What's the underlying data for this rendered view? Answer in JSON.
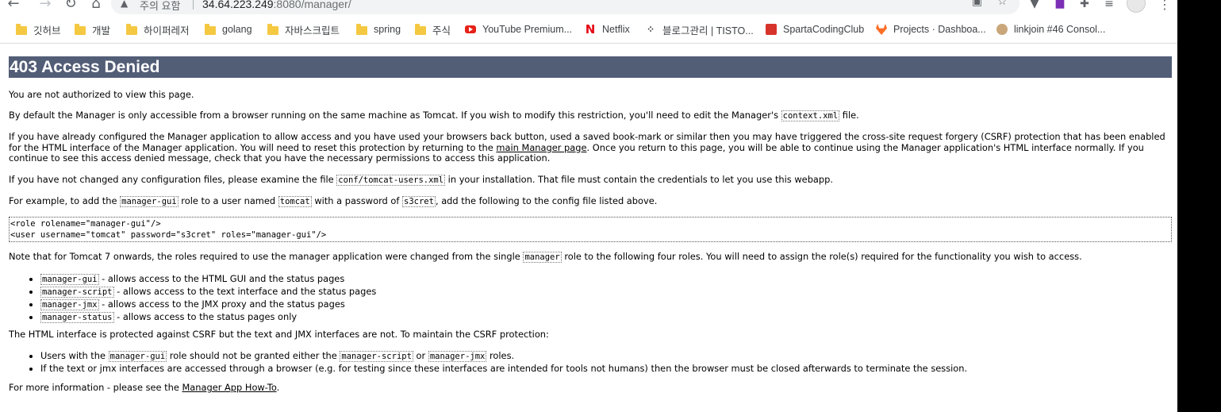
{
  "browser": {
    "security_label": "주의 요함",
    "url_host": "34.64.223.249",
    "url_rest": ":8080/manager/",
    "bookmarks": [
      {
        "label": "깃허브",
        "icon": "folder-icon"
      },
      {
        "label": "개발",
        "icon": "folder-icon"
      },
      {
        "label": "하이퍼레저",
        "icon": "folder-icon"
      },
      {
        "label": "golang",
        "icon": "folder-icon"
      },
      {
        "label": "자바스크립트",
        "icon": "folder-icon"
      },
      {
        "label": "spring",
        "icon": "folder-icon"
      },
      {
        "label": "주식",
        "icon": "folder-icon"
      },
      {
        "label": "YouTube Premium...",
        "icon": "youtube-icon"
      },
      {
        "label": "Netflix",
        "icon": "netflix-icon"
      },
      {
        "label": "블로그관리 | TISTO...",
        "icon": "tistory-icon"
      },
      {
        "label": "SpartaCodingClub",
        "icon": "spartacoding-icon"
      },
      {
        "label": "Projects · Dashboa...",
        "icon": "gitlab-icon"
      },
      {
        "label": "linkjoin #46 Consol...",
        "icon": "linkjoin-icon"
      }
    ]
  },
  "page": {
    "title": "403 Access Denied",
    "p1": "You are not authorized to view this page.",
    "p2_a": "By default the Manager is only accessible from a browser running on the same machine as Tomcat. If you wish to modify this restriction, you'll need to edit the Manager's ",
    "p2_code": "context.xml",
    "p2_b": " file.",
    "p3_a": "If you have already configured the Manager application to allow access and you have used your browsers back button, used a saved book-mark or similar then you may have triggered the cross-site request forgery (CSRF) protection that has been enabled for the HTML interface of the Manager application. You will need to reset this protection by returning to the ",
    "p3_link": "main Manager page",
    "p3_b": ". Once you return to this page, you will be able to continue using the Manager application's HTML interface normally. If you continue to see this access denied message, check that you have the necessary permissions to access this application.",
    "p4_a": "If you have not changed any configuration files, please examine the file ",
    "p4_code": "conf/tomcat-users.xml",
    "p4_b": " in your installation. That file must contain the credentials to let you use this webapp.",
    "p5_a": "For example, to add the ",
    "p5_code1": "manager-gui",
    "p5_b": " role to a user named ",
    "p5_code2": "tomcat",
    "p5_c": " with a password of ",
    "p5_code3": "s3cret",
    "p5_d": ", add the following to the config file listed above.",
    "pre_line1": "<role rolename=\"manager-gui\"/>",
    "pre_line2": "<user username=\"tomcat\" password=\"s3cret\" roles=\"manager-gui\"/>",
    "p6_a": "Note that for Tomcat 7 onwards, the roles required to use the manager application were changed from the single ",
    "p6_code": "manager",
    "p6_b": " role to the following four roles. You will need to assign the role(s) required for the functionality you wish to access.",
    "roles": [
      {
        "code": "manager-gui",
        "text": " - allows access to the HTML GUI and the status pages"
      },
      {
        "code": "manager-script",
        "text": " - allows access to the text interface and the status pages"
      },
      {
        "code": "manager-jmx",
        "text": " - allows access to the JMX proxy and the status pages"
      },
      {
        "code": "manager-status",
        "text": " - allows access to the status pages only"
      }
    ],
    "p7": "The HTML interface is protected against CSRF but the text and JMX interfaces are not. To maintain the CSRF protection:",
    "csrf1_a": "Users with the ",
    "csrf1_code1": "manager-gui",
    "csrf1_b": " role should not be granted either the ",
    "csrf1_code2": "manager-script",
    "csrf1_c": " or ",
    "csrf1_code3": "manager-jmx",
    "csrf1_d": " roles.",
    "csrf2": "If the text or jmx interfaces are accessed through a browser (e.g. for testing since these interfaces are intended for tools not humans) then the browser must be closed afterwards to terminate the session.",
    "p8_a": "For more information - please see the ",
    "p8_link": "Manager App How-To",
    "p8_b": "."
  }
}
